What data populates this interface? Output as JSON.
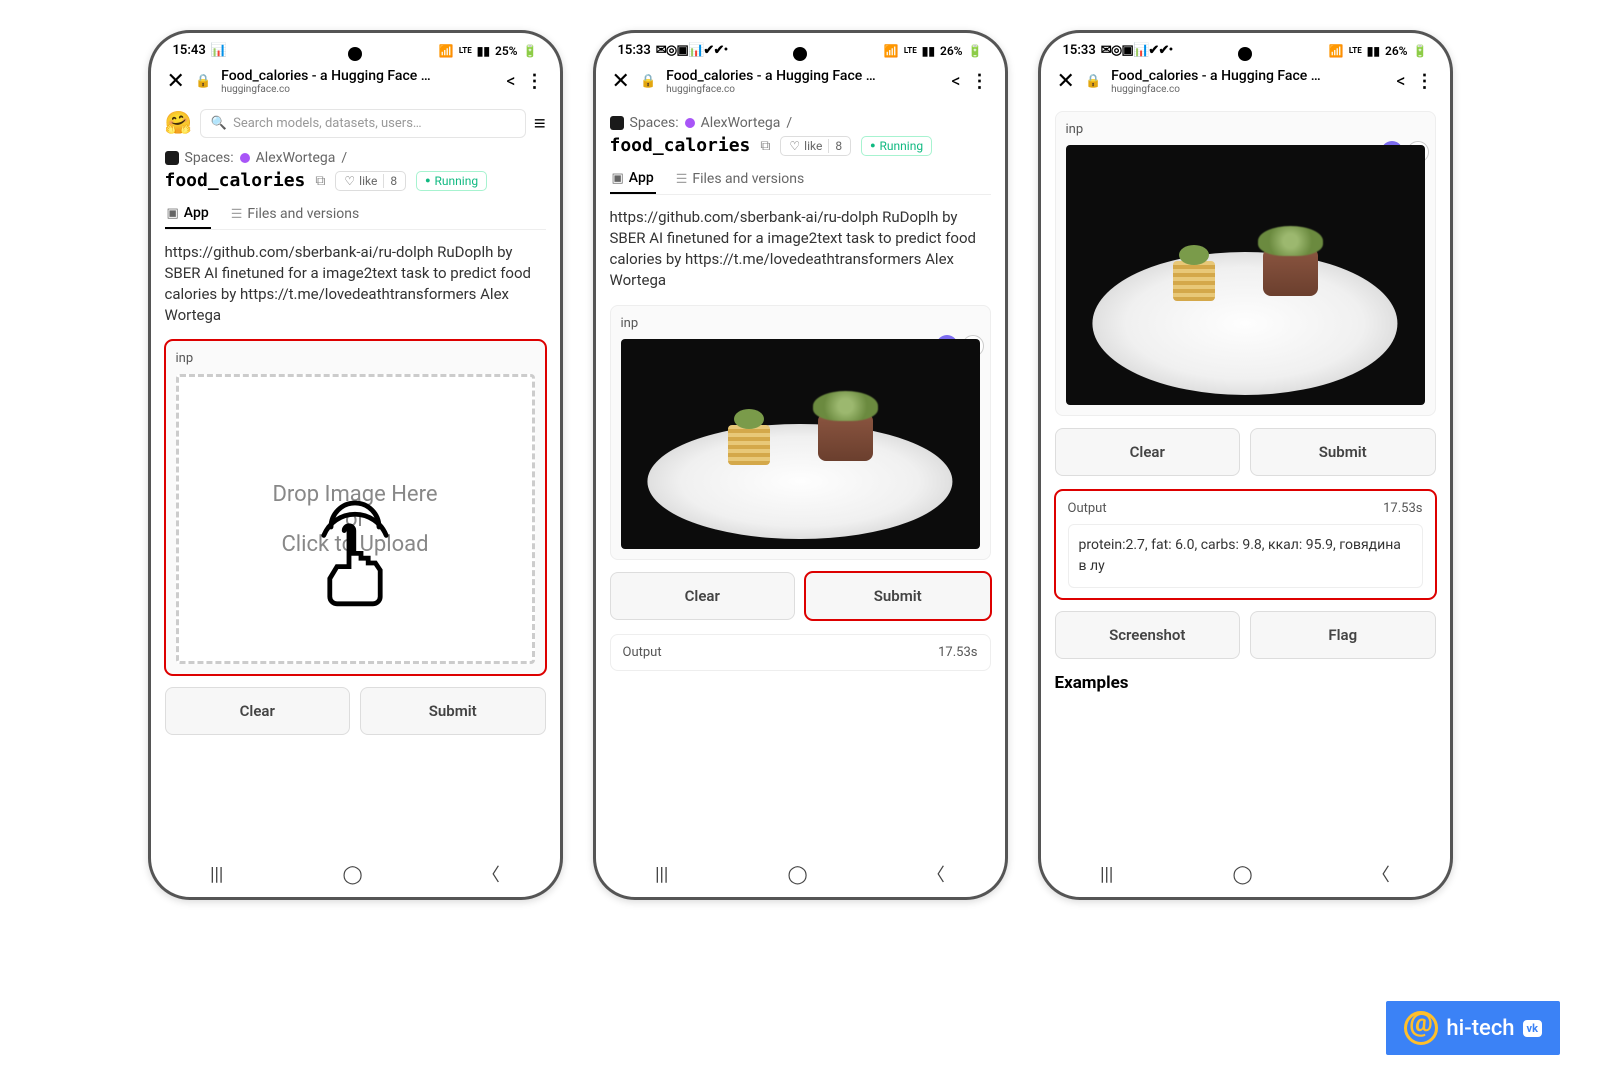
{
  "watermark": {
    "text": "hi-tech",
    "badge": "vk"
  },
  "common": {
    "browser": {
      "title": "Food_calories - a Hugging Face …",
      "host": "huggingface.co"
    },
    "breadcrumb": {
      "spaces": "Spaces:",
      "user": "AlexWortega",
      "slash": "/"
    },
    "project": {
      "name": "food_calories",
      "like_label": "like",
      "like_count": "8",
      "running": "Running"
    },
    "tabs": {
      "app": "App",
      "files": "Files and versions"
    },
    "desc": "https://github.com/sberbank-ai/ru-dolph RuDoplh by SBER AI finetuned for a image2text task to predict food calories by https://t.me/lovedeathtransformers Alex Wortega",
    "inp_label": "inp",
    "drop": {
      "l1": "Drop Image Here",
      "l2": "- or -",
      "l3": "Click to Upload"
    },
    "buttons": {
      "clear": "Clear",
      "submit": "Submit",
      "screenshot": "Screenshot",
      "flag": "Flag"
    },
    "output": {
      "label": "Output",
      "time": "17.53s",
      "text": "protein:2.7, fat: 6.0, carbs: 9.8, ккал: 95.9, говядина в лу"
    },
    "examples": "Examples",
    "search_placeholder": "Search models, datasets, users…"
  },
  "phone1": {
    "status": {
      "time": "15:43",
      "battery": "25%"
    }
  },
  "phone2": {
    "status": {
      "time": "15:33",
      "battery": "26%"
    }
  },
  "phone3": {
    "status": {
      "time": "15:33",
      "battery": "26%"
    }
  }
}
